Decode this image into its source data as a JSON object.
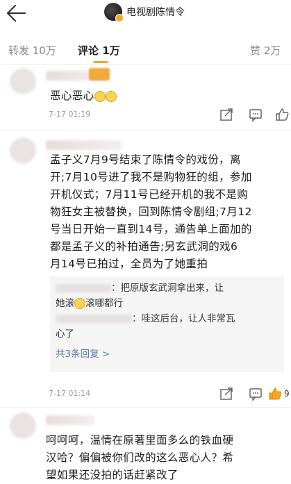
{
  "header": {
    "account_name": "电视剧陈情令"
  },
  "tabs": [
    {
      "label": "转发 10万"
    },
    {
      "label": "评论 1万"
    },
    {
      "label": "赞 2万"
    }
  ],
  "comments": [
    {
      "text": "恶心恶心",
      "time": "7-17 01:19"
    },
    {
      "text_lines": [
        "孟子义7月9号结束了陈情令的戏份，离",
        "开;7月10号进了我不是购物狂的组，参加",
        "开机仪式；7月11号已经开机的我不是购",
        "物狂女主被替换，回到陈情令剧组;7月12",
        "号当日开始一直到14号，通告单上面加的",
        "都是孟子义的补拍通告;另玄武洞的戏6",
        "月14号已拍过，全员为了她重拍"
      ],
      "replies": [
        {
          "line1": "：把原版玄武洞拿出来，让",
          "line2a": "她滚",
          "line2b": "滚哪都行"
        },
        {
          "line1": "：哇这后台，让人非常瓦",
          "line2": "心了"
        }
      ],
      "more_replies": "共3条回复 >",
      "time": "7-17 01:14",
      "likes": "9"
    },
    {
      "text_lines": [
        "呵呵呵，温情在原著里面多么的铁血硬",
        "汉哈？偏偏被你们改的这么恶心人？希",
        "望如果还没拍的话赶紧改了"
      ]
    }
  ]
}
